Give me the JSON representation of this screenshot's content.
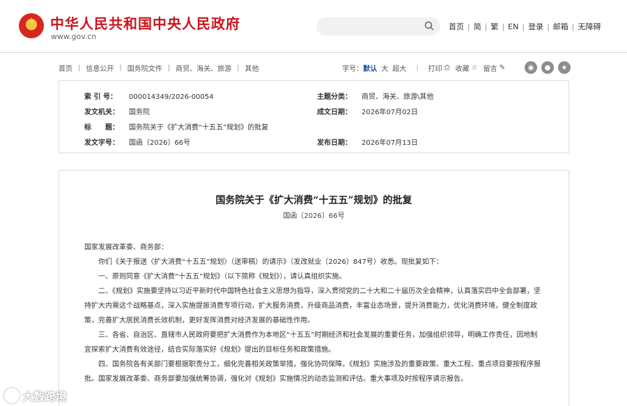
{
  "header": {
    "site_name": "中华人民共和国中央人民政府",
    "site_domain": "www.gov.cn",
    "search_placeholder": "",
    "nav": [
      "首页",
      "简",
      "繁",
      "EN",
      "登录",
      "邮箱",
      "无障碍"
    ]
  },
  "breadcrumb": [
    "首页",
    "信息公开",
    "国务院文件",
    "商贸、海关、旅游",
    "其他"
  ],
  "tools": {
    "font_size_label": "字号：",
    "size_default": "默认",
    "size_large": "大",
    "size_xlarge": "超大",
    "print": "打印",
    "favorite": "收藏",
    "comment": "留言"
  },
  "meta": {
    "index_label": "索 引 号：",
    "index_value": "000014349/2026-00054",
    "topic_label": "主题分类：",
    "topic_value": "商贸、海关、旅游\\其他",
    "issuer_label": "发文机关：",
    "issuer_value": "国务院",
    "written_label": "成文日期：",
    "written_value": "2026年07月02日",
    "title_label": "标　　题：",
    "title_value": "国务院关于《扩大消费“十五五”规划》的批复",
    "docno_label": "发文字号：",
    "docno_value": "国函〔2026〕66号",
    "published_label": "发布日期：",
    "published_value": "2026年07月13日"
  },
  "document": {
    "title": "国务院关于《扩大消费“十五五”规划》的批复",
    "number": "国函〔2026〕66号",
    "addressee": "国家发展改革委、商务部：",
    "paragraphs": [
      "你们《关于报送〈扩大消费“十五五”规划〉（送审稿）的请示》（发改就业〔2026〕847号）收悉。现批复如下：",
      "一、原则同意《扩大消费“十五五”规划》（以下简称《规划》），请认真组织实施。",
      "二、《规划》实施要坚持以习近平新时代中国特色社会主义思想为指导，深入贯彻党的二十大和二十届历次全会精神，认真落实四中全会部署，坚持扩大内需这个战略基点，深入实施提振消费专项行动，扩大服务消费，升级商品消费，丰富业态场景，提升消费能力，优化消费环境，健全制度政策，完善扩大居民消费长效机制，更好发挥消费对经济发展的基础性作用。",
      "三、各省、自治区、直辖市人民政府要把扩大消费作为本地区“十五五”时期经济和社会发展的重要任务，加强组织领导，明确工作责任，因地制宜探索扩大消费有效途径，结合实际落实好《规划》提出的目标任务和政策措施。",
      "四、国务院各有关部门要根据职责分工，细化完善相关政策举措，强化协同保障。《规划》实施涉及的重要政策、重大工程、重点项目要按程序报批。国家发展改革委、商务部要加强统筹协调，强化对《规划》实施情况的动态监测和评估。重大事项及时按程序请示报告。"
    ]
  },
  "watermark": "大数跨境"
}
